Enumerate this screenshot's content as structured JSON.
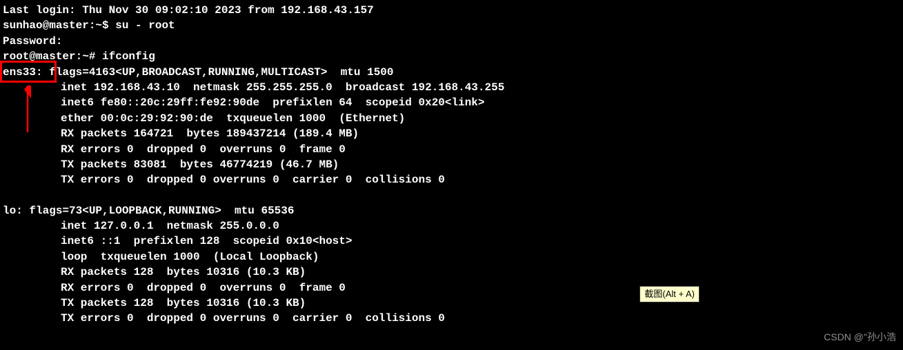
{
  "login": {
    "last_login": "Last login: Thu Nov 30 09:02:10 2023 from 192.168.43.157",
    "prompt1": "sunhao@master:~$ su - root",
    "password": "Password:",
    "prompt2": "root@master:~# ifconfig"
  },
  "ens33": {
    "name": "ens33: ",
    "flags": "flags=4163<UP,BROADCAST,RUNNING,MULTICAST>  mtu 1500",
    "inet": "inet 192.168.43.10  netmask 255.255.255.0  broadcast 192.168.43.255",
    "inet6": "inet6 fe80::20c:29ff:fe92:90de  prefixlen 64  scopeid 0x20<link>",
    "ether": "ether 00:0c:29:92:90:de  txqueuelen 1000  (Ethernet)",
    "rx_packets": "RX packets 164721  bytes 189437214 (189.4 MB)",
    "rx_errors": "RX errors 0  dropped 0  overruns 0  frame 0",
    "tx_packets": "TX packets 83081  bytes 46774219 (46.7 MB)",
    "tx_errors": "TX errors 0  dropped 0 overruns 0  carrier 0  collisions 0"
  },
  "lo": {
    "header": "lo: flags=73<UP,LOOPBACK,RUNNING>  mtu 65536",
    "inet": "inet 127.0.0.1  netmask 255.0.0.0",
    "inet6": "inet6 ::1  prefixlen 128  scopeid 0x10<host>",
    "loop": "loop  txqueuelen 1000  (Local Loopback)",
    "rx_packets": "RX packets 128  bytes 10316 (10.3 KB)",
    "rx_errors": "RX errors 0  dropped 0  overruns 0  frame 0",
    "tx_packets": "TX packets 128  bytes 10316 (10.3 KB)",
    "tx_errors": "TX errors 0  dropped 0 overruns 0  carrier 0  collisions 0"
  },
  "tooltip": {
    "text": "截图(Alt + A)"
  },
  "watermark": {
    "text": "CSDN @\"孙小浩"
  }
}
